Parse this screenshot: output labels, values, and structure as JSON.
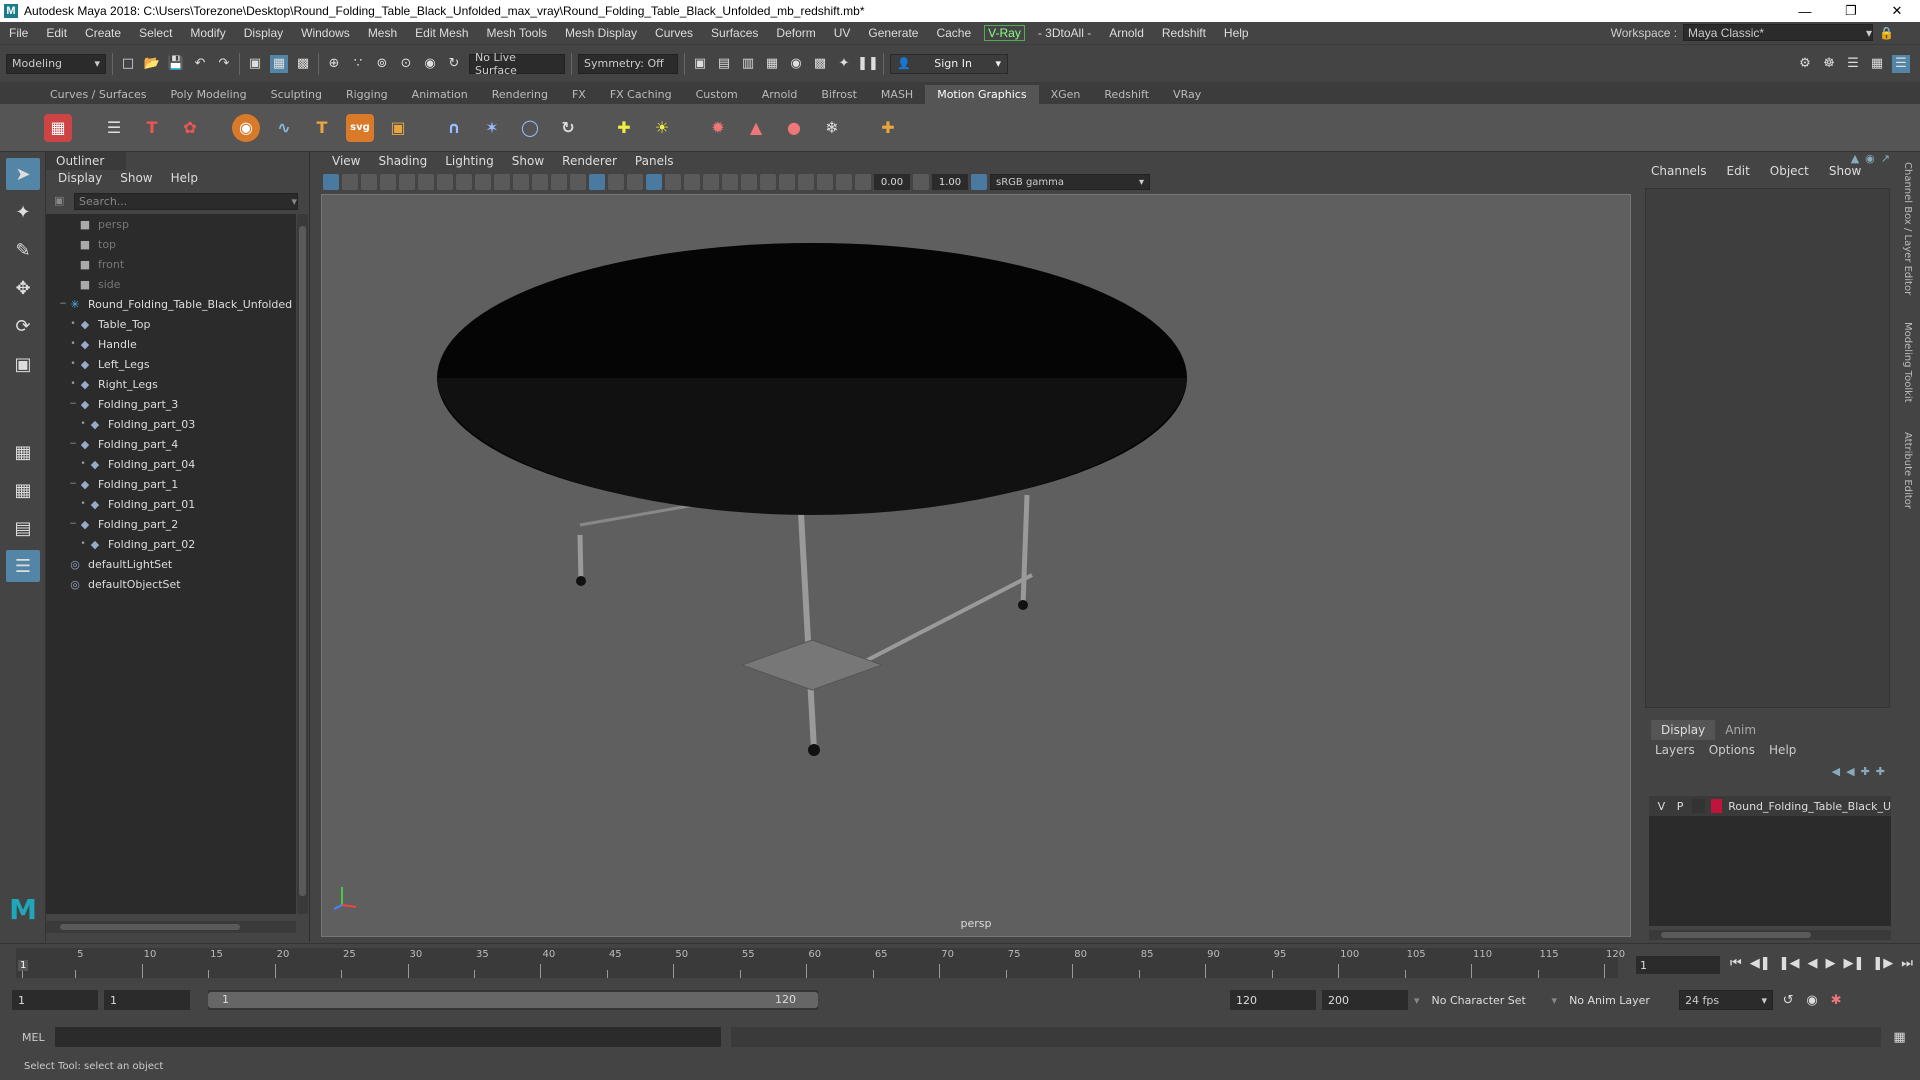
{
  "window": {
    "title": "Autodesk Maya 2018: C:\\Users\\Torezone\\Desktop\\Round_Folding_Table_Black_Unfolded_max_vray\\Round_Folding_Table_Black_Unfolded_mb_redshift.mb*"
  },
  "menubar": {
    "items": [
      "File",
      "Edit",
      "Create",
      "Select",
      "Modify",
      "Display",
      "Windows",
      "Mesh",
      "Edit Mesh",
      "Mesh Tools",
      "Mesh Display",
      "Curves",
      "Surfaces",
      "Deform",
      "UV",
      "Generate",
      "Cache"
    ],
    "vray": "V-Ray",
    "items2": [
      "- 3DtoAll -",
      "Arnold",
      "Redshift",
      "Help"
    ],
    "workspace_label": "Workspace :",
    "workspace_value": "Maya Classic*"
  },
  "toolbar": {
    "mode": "Modeling",
    "live_surface": "No Live Surface",
    "symmetry": "Symmetry: Off",
    "sign_in": "Sign In"
  },
  "shelf": {
    "tabs": [
      "Curves / Surfaces",
      "Poly Modeling",
      "Sculpting",
      "Rigging",
      "Animation",
      "Rendering",
      "FX",
      "FX Caching",
      "Custom",
      "Arnold",
      "Bifrost",
      "MASH",
      "Motion Graphics",
      "XGen",
      "Redshift",
      "VRay"
    ],
    "active_tab": "Motion Graphics",
    "svg_label": "svg"
  },
  "outliner": {
    "tab": "Outliner",
    "menu": [
      "Display",
      "Show",
      "Help"
    ],
    "search_placeholder": "Search...",
    "rows": [
      {
        "label": "persp",
        "indent": 1,
        "icon": "camera-icon",
        "dim": true,
        "expander": ""
      },
      {
        "label": "top",
        "indent": 1,
        "icon": "camera-icon",
        "dim": true,
        "expander": ""
      },
      {
        "label": "front",
        "indent": 1,
        "icon": "camera-icon",
        "dim": true,
        "expander": ""
      },
      {
        "label": "side",
        "indent": 1,
        "icon": "camera-icon",
        "dim": true,
        "expander": ""
      },
      {
        "label": "Round_Folding_Table_Black_Unfolded",
        "indent": 0,
        "icon": "group-icon",
        "dim": false,
        "expander": "−"
      },
      {
        "label": "Table_Top",
        "indent": 1,
        "icon": "mesh-icon",
        "dim": false,
        "expander": "•"
      },
      {
        "label": "Handle",
        "indent": 1,
        "icon": "mesh-icon",
        "dim": false,
        "expander": "•"
      },
      {
        "label": "Left_Legs",
        "indent": 1,
        "icon": "mesh-icon",
        "dim": false,
        "expander": "•"
      },
      {
        "label": "Right_Legs",
        "indent": 1,
        "icon": "mesh-icon",
        "dim": false,
        "expander": "•"
      },
      {
        "label": "Folding_part_3",
        "indent": 1,
        "icon": "mesh-icon",
        "dim": false,
        "expander": "−"
      },
      {
        "label": "Folding_part_03",
        "indent": 2,
        "icon": "mesh-icon",
        "dim": false,
        "expander": "•"
      },
      {
        "label": "Folding_part_4",
        "indent": 1,
        "icon": "mesh-icon",
        "dim": false,
        "expander": "−"
      },
      {
        "label": "Folding_part_04",
        "indent": 2,
        "icon": "mesh-icon",
        "dim": false,
        "expander": "•"
      },
      {
        "label": "Folding_part_1",
        "indent": 1,
        "icon": "mesh-icon",
        "dim": false,
        "expander": "−"
      },
      {
        "label": "Folding_part_01",
        "indent": 2,
        "icon": "mesh-icon",
        "dim": false,
        "expander": "•"
      },
      {
        "label": "Folding_part_2",
        "indent": 1,
        "icon": "mesh-icon",
        "dim": false,
        "expander": "−"
      },
      {
        "label": "Folding_part_02",
        "indent": 2,
        "icon": "mesh-icon",
        "dim": false,
        "expander": "•"
      },
      {
        "label": "defaultLightSet",
        "indent": 0,
        "icon": "set-icon",
        "dim": false,
        "expander": ""
      },
      {
        "label": "defaultObjectSet",
        "indent": 0,
        "icon": "set-icon",
        "dim": false,
        "expander": ""
      }
    ]
  },
  "viewport": {
    "menu": [
      "View",
      "Shading",
      "Lighting",
      "Show",
      "Renderer",
      "Panels"
    ],
    "exposure": "0.00",
    "gamma": "1.00",
    "color_space": "sRGB gamma",
    "camera_label": "persp"
  },
  "channelbox": {
    "menu": [
      "Channels",
      "Edit",
      "Object",
      "Show"
    ],
    "layer_tabs": [
      "Display",
      "Anim"
    ],
    "layer_menu": [
      "Layers",
      "Options",
      "Help"
    ],
    "layer": {
      "v": "V",
      "p": "P",
      "name": "Round_Folding_Table_Black_U",
      "color": "#c0143c"
    }
  },
  "side_tabs": [
    "Channel Box / Layer Editor",
    "Modeling Toolkit",
    "Attribute Editor"
  ],
  "timeline": {
    "labels": [
      "5",
      "10",
      "15",
      "20",
      "25",
      "30",
      "35",
      "40",
      "45",
      "50",
      "55",
      "60",
      "65",
      "70",
      "75",
      "80",
      "85",
      "90",
      "95",
      "100",
      "105",
      "110",
      "115",
      "120"
    ],
    "current_marker": "1",
    "current_frame": "1"
  },
  "range": {
    "start": "1",
    "playback_start": "1",
    "slider_start": "1",
    "slider_end": "120",
    "playback_end": "120",
    "end": "200",
    "character_set": "No Character Set",
    "anim_layer": "No Anim Layer",
    "fps": "24 fps"
  },
  "cmdline": {
    "label": "MEL"
  },
  "status": {
    "text": "Select Tool: select an object"
  }
}
